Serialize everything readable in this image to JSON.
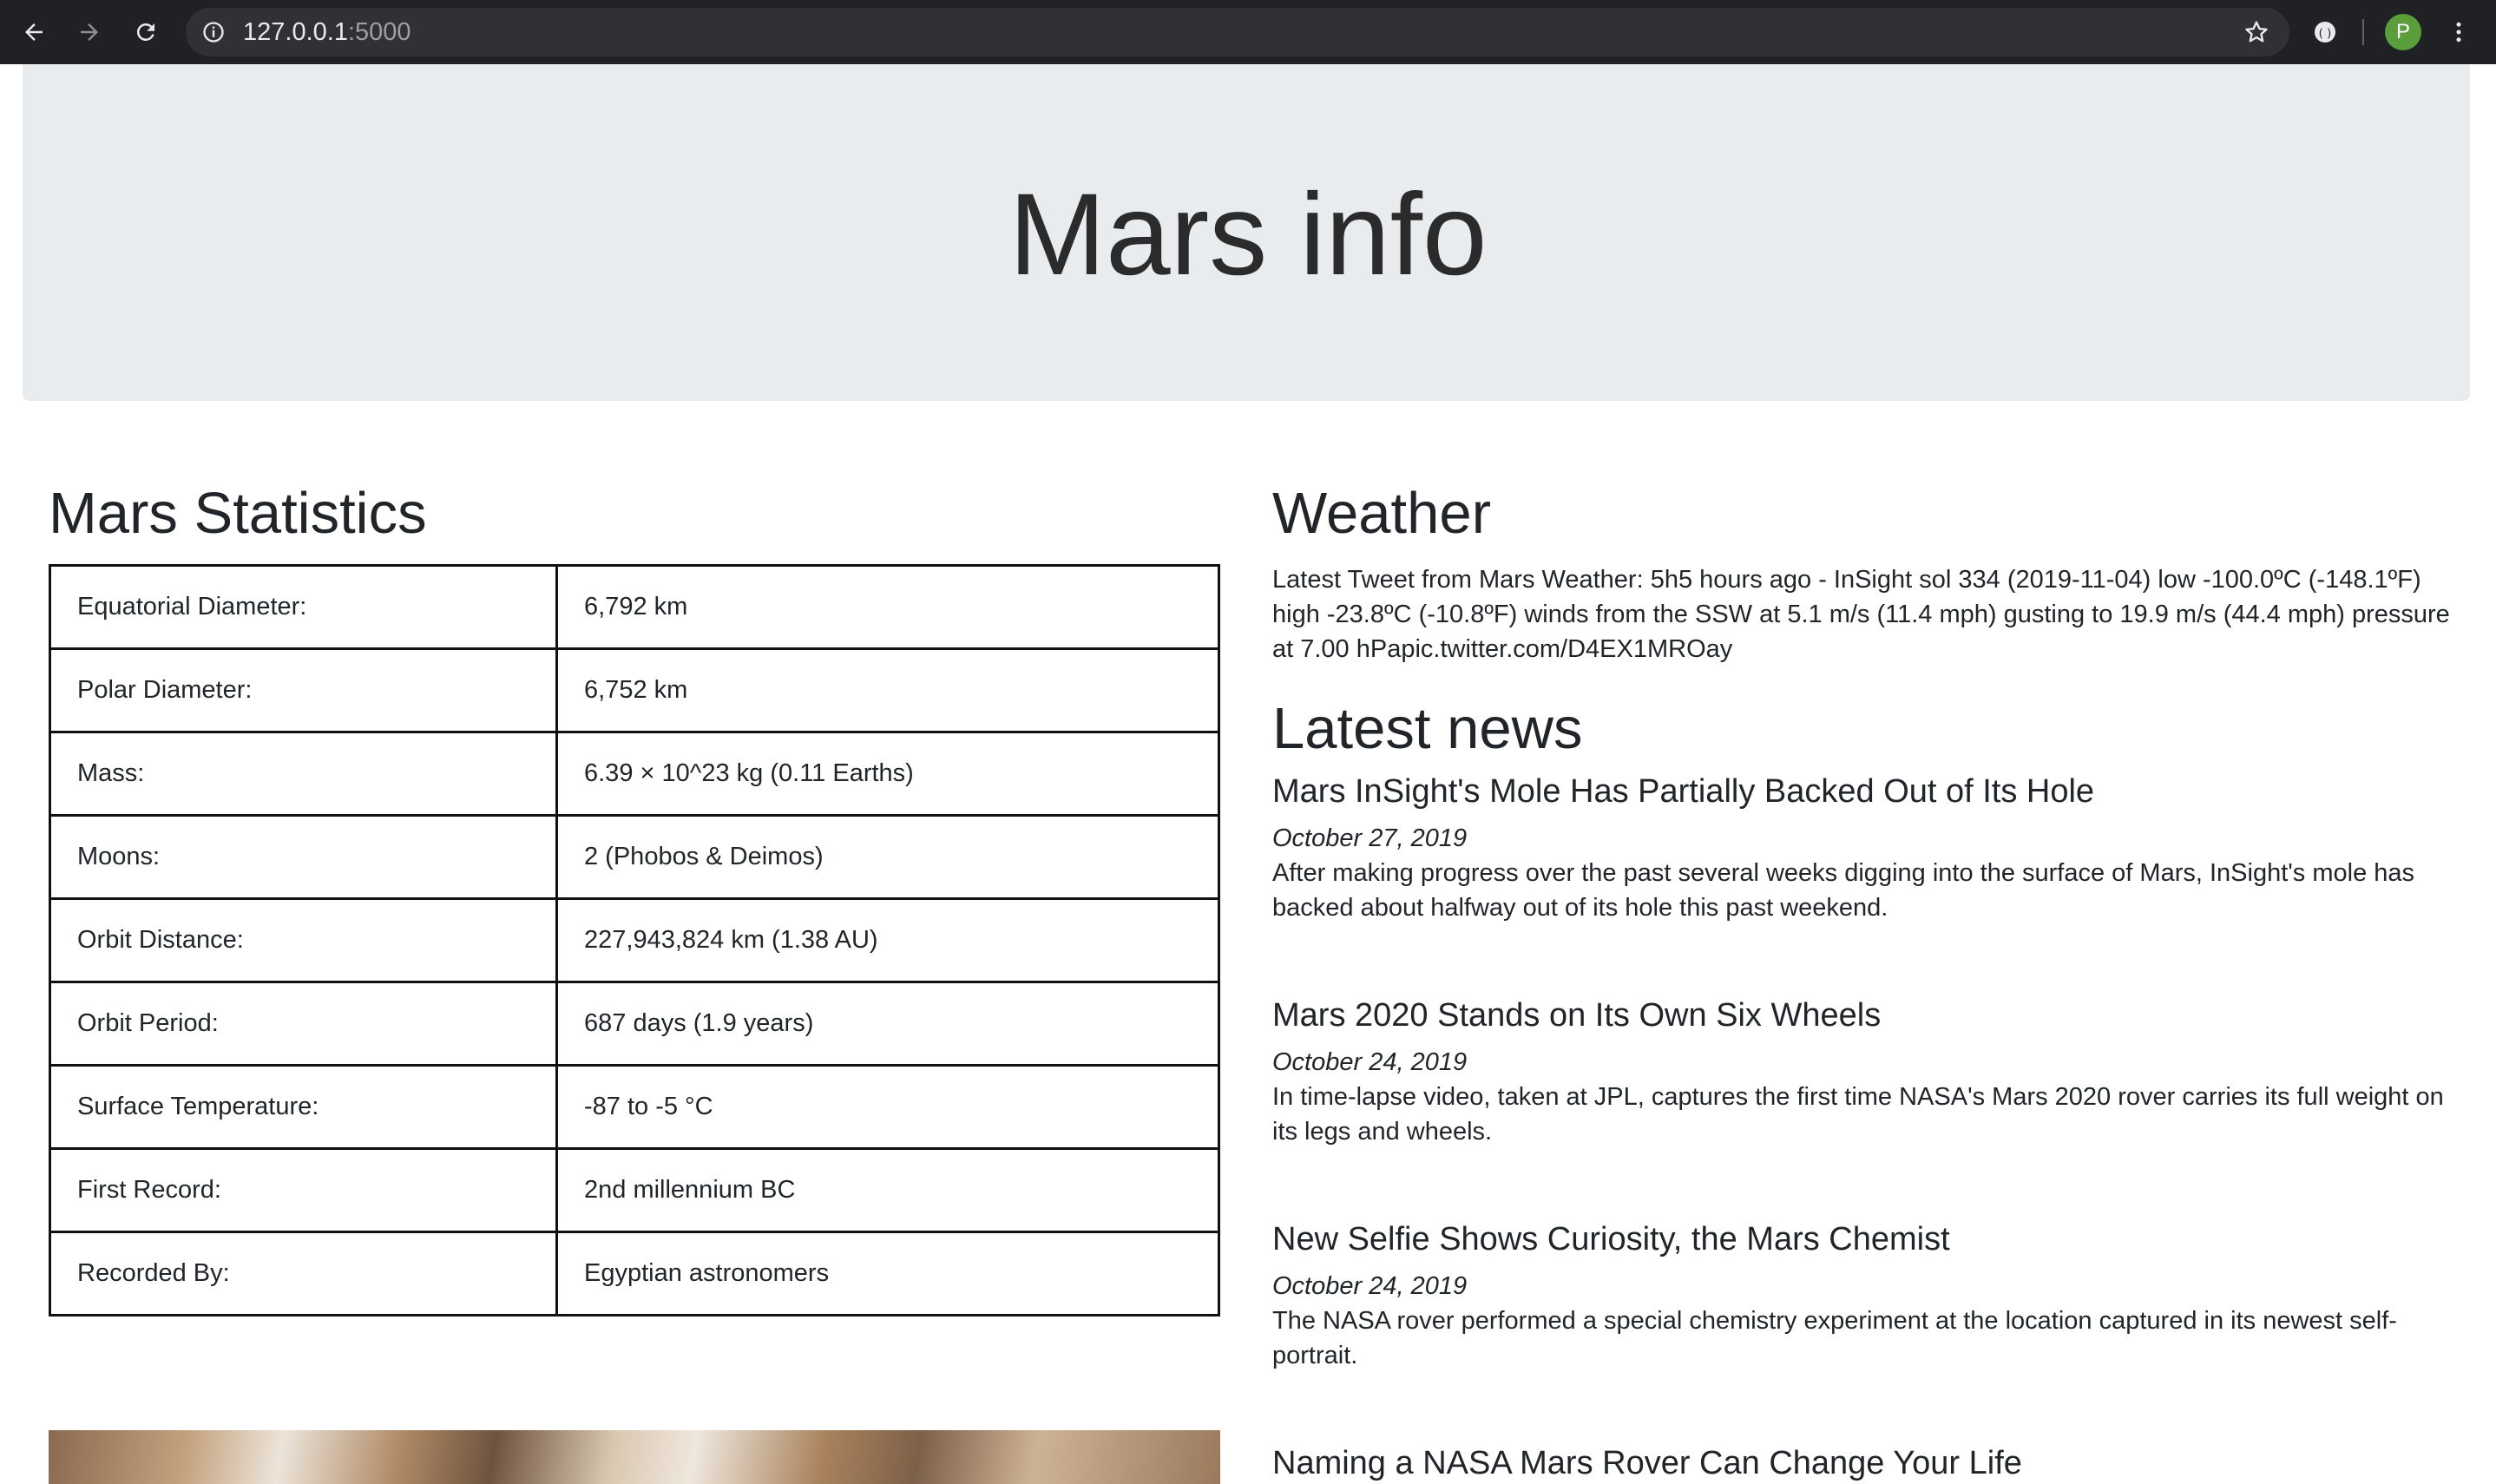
{
  "browser": {
    "url_host": "127.0.0.1",
    "url_port": ":5000",
    "avatar_letter": "P",
    "colors": {
      "chrome_bg": "#202124",
      "omnibox_bg": "#303134",
      "avatar_bg": "#5a9e3c"
    }
  },
  "page": {
    "title": "Mars info",
    "statistics": {
      "heading": "Mars Statistics",
      "rows": [
        {
          "label": "Equatorial Diameter:",
          "value": "6,792 km"
        },
        {
          "label": "Polar Diameter:",
          "value": "6,752 km"
        },
        {
          "label": "Mass:",
          "value": "6.39 × 10^23 kg (0.11 Earths)"
        },
        {
          "label": "Moons:",
          "value": "2 (Phobos & Deimos)"
        },
        {
          "label": "Orbit Distance:",
          "value": "227,943,824 km (1.38 AU)"
        },
        {
          "label": "Orbit Period:",
          "value": "687 days (1.9 years)"
        },
        {
          "label": "Surface Temperature:",
          "value": "-87 to -5 °C"
        },
        {
          "label": "First Record:",
          "value": "2nd millennium BC"
        },
        {
          "label": "Recorded By:",
          "value": "Egyptian astronomers"
        }
      ]
    },
    "weather": {
      "heading": "Weather",
      "text": "Latest Tweet from Mars Weather: 5h5 hours ago - InSight sol 334 (2019-11-04) low -100.0ºC (-148.1ºF) high -23.8ºC (-10.8ºF) winds from the SSW at 5.1 m/s (11.4 mph) gusting to 19.9 m/s (44.4 mph) pressure at 7.00 hPapic.twitter.com/D4EX1MROay"
    },
    "news": {
      "heading": "Latest news",
      "items": [
        {
          "headline": "Mars InSight's Mole Has Partially Backed Out of Its Hole",
          "date": "October 27, 2019",
          "teaser": "After making progress over the past several weeks digging into the surface of Mars, InSight's mole has backed about halfway out of its hole this past weekend."
        },
        {
          "headline": "Mars 2020 Stands on Its Own Six Wheels",
          "date": "October 24, 2019",
          "teaser": "In time-lapse video, taken at JPL, captures the first time NASA's Mars 2020 rover carries its full weight on its legs and wheels."
        },
        {
          "headline": "New Selfie Shows Curiosity, the Mars Chemist",
          "date": "October 24, 2019",
          "teaser": "The NASA rover performed a special chemistry experiment at the location captured in its newest self-portrait."
        },
        {
          "headline": "Naming a NASA Mars Rover Can Change Your Life"
        }
      ]
    }
  }
}
